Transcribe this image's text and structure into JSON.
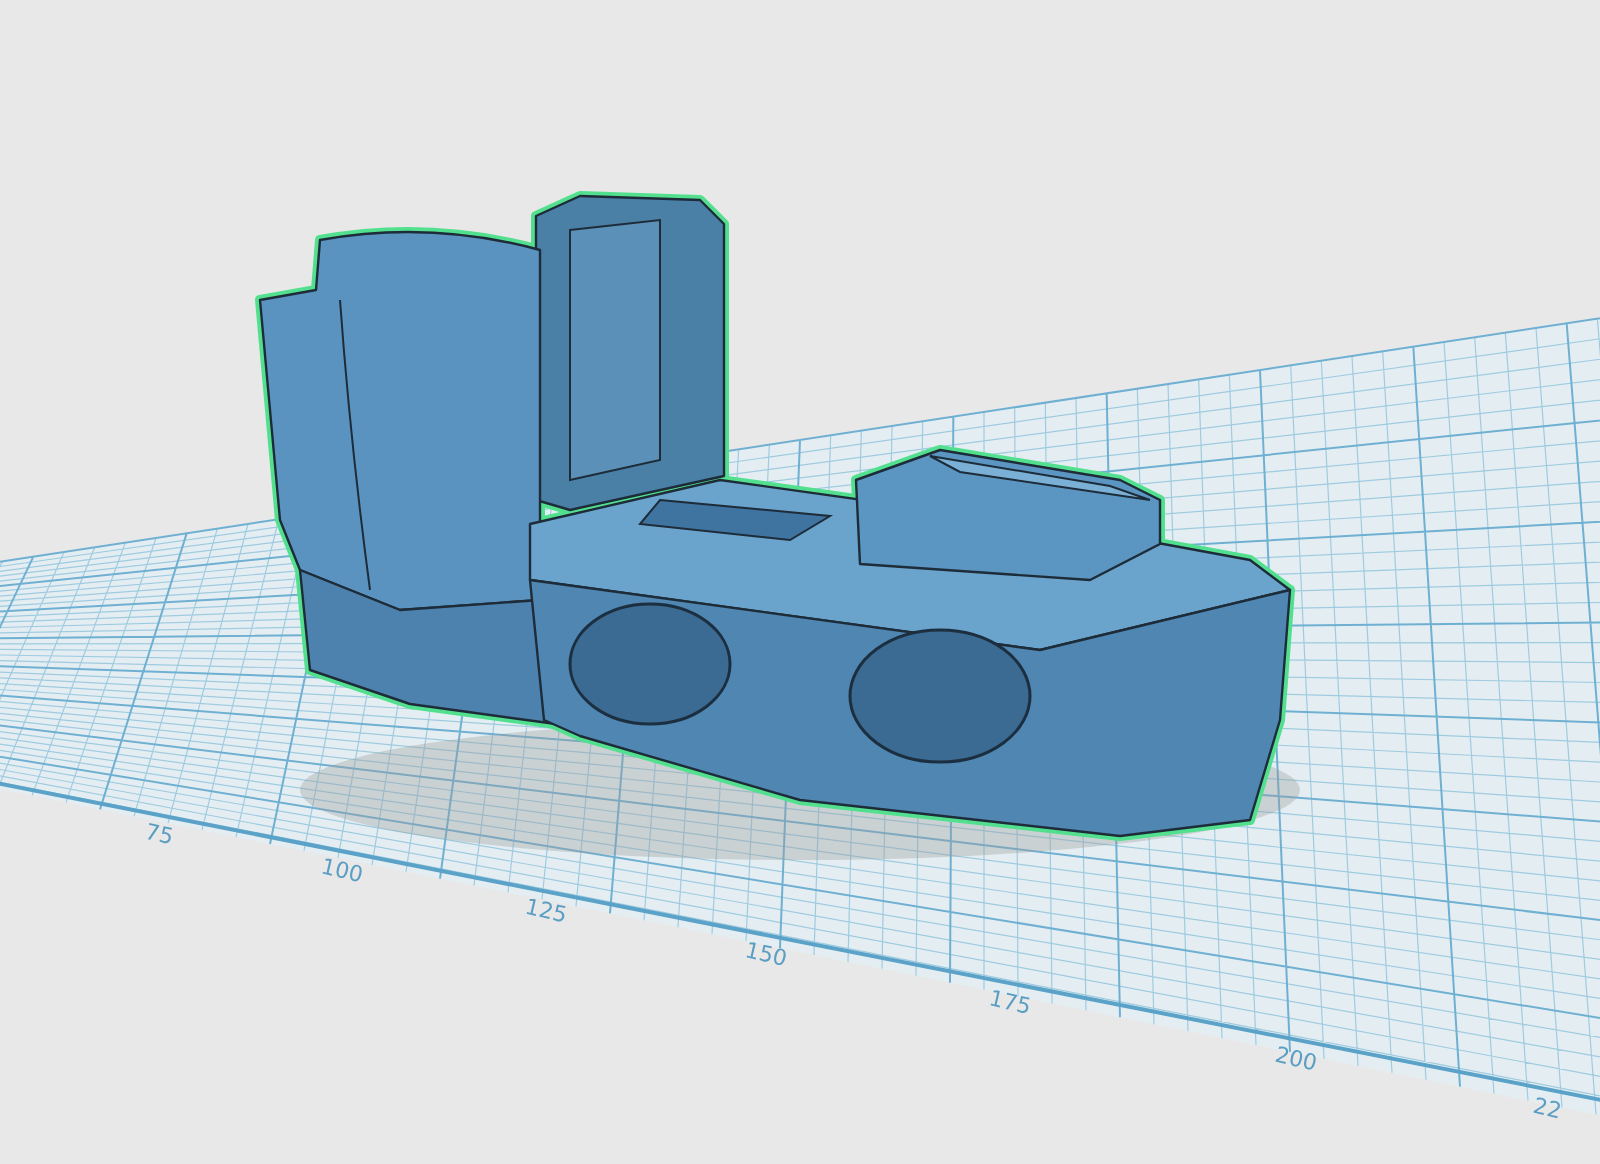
{
  "viewport": {
    "axis_labels": [
      "75",
      "100",
      "125",
      "150",
      "175",
      "200",
      "22"
    ]
  }
}
